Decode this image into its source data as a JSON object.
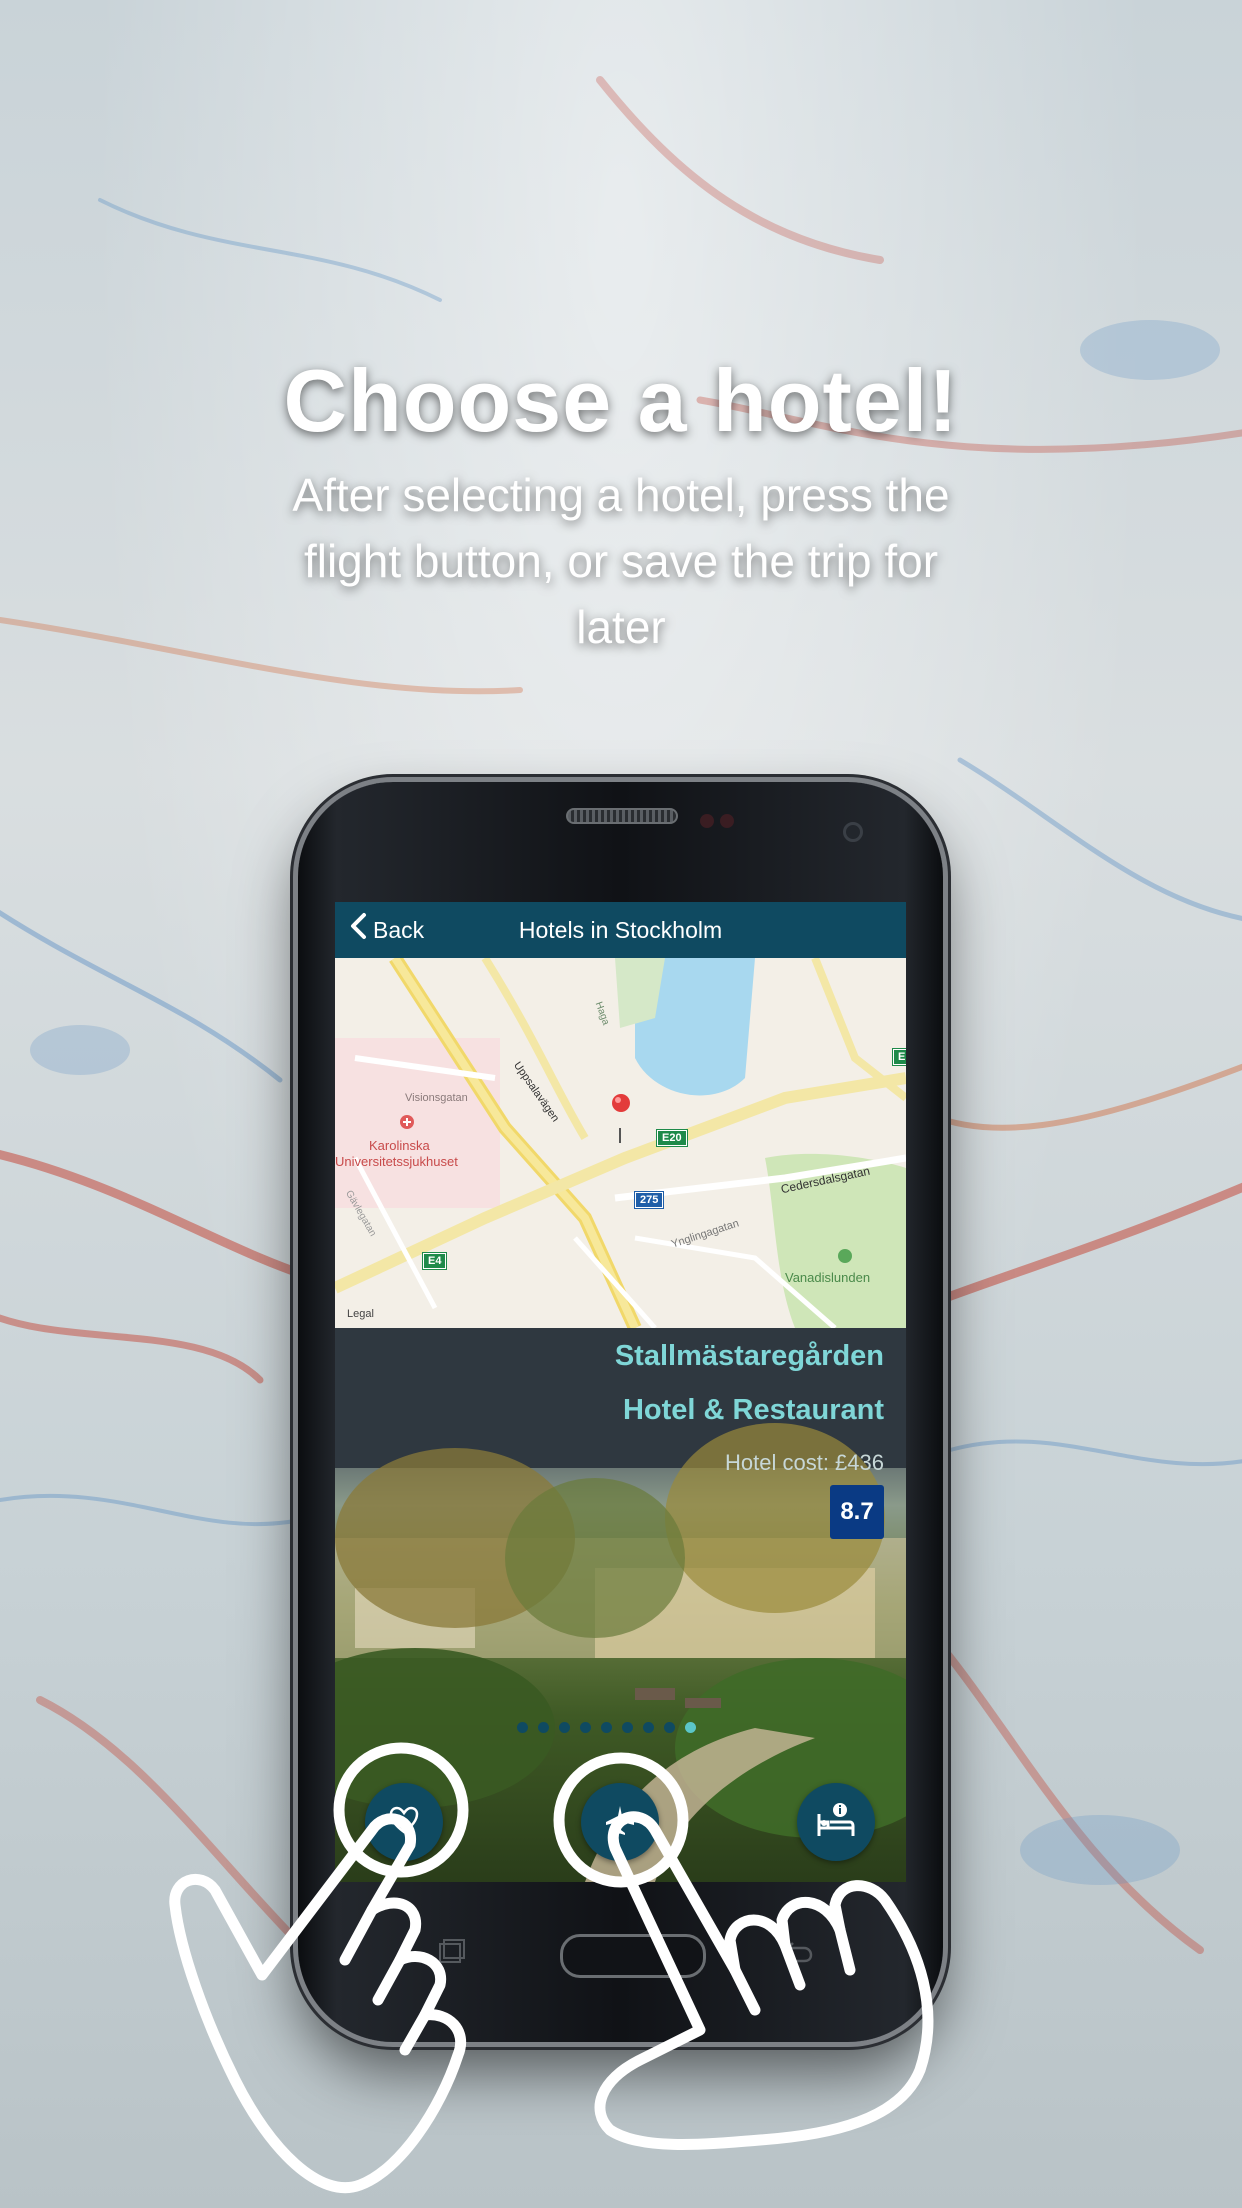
{
  "headline": {
    "title": "Choose a hotel!",
    "subtitle": "After selecting a hotel, press the flight button, or save the trip for later"
  },
  "navbar": {
    "back_label": "Back",
    "title": "Hotels in Stockholm"
  },
  "map": {
    "labels": {
      "karolinska_1": "Karolinska",
      "karolinska_2": "Universitetssjukhuset",
      "visionsgatan": "Visionsgatan",
      "uppsalavagen": "Uppsalavägen",
      "haga": "Haga",
      "cedersdalsgatan": "Cedersdalsgatan",
      "ynglingagatan": "Ynglingagatan",
      "vanadislunden": "Vanadislunden",
      "gavlegatan": "Gävlegatan",
      "legal": "Legal"
    },
    "road_shields": {
      "e20": "E20",
      "r275": "275",
      "e4": "E4",
      "edge": "E"
    }
  },
  "hotel": {
    "name_line1": "Stallmästaregården",
    "name_line2": "Hotel & Restaurant",
    "cost": "Hotel cost: £436",
    "rating": "8.7",
    "carousel": {
      "count": 9,
      "active_index": 8
    }
  },
  "actions": {
    "save_icon": "heart-icon",
    "flight_icon": "airplane-icon",
    "info_icon": "hotel-bed-info-icon"
  },
  "colors": {
    "navbar": "#0f4a61",
    "hotel_name": "#7fd6d7",
    "rating_badge": "#0a3a84",
    "dot_active": "#5bc6c9"
  }
}
